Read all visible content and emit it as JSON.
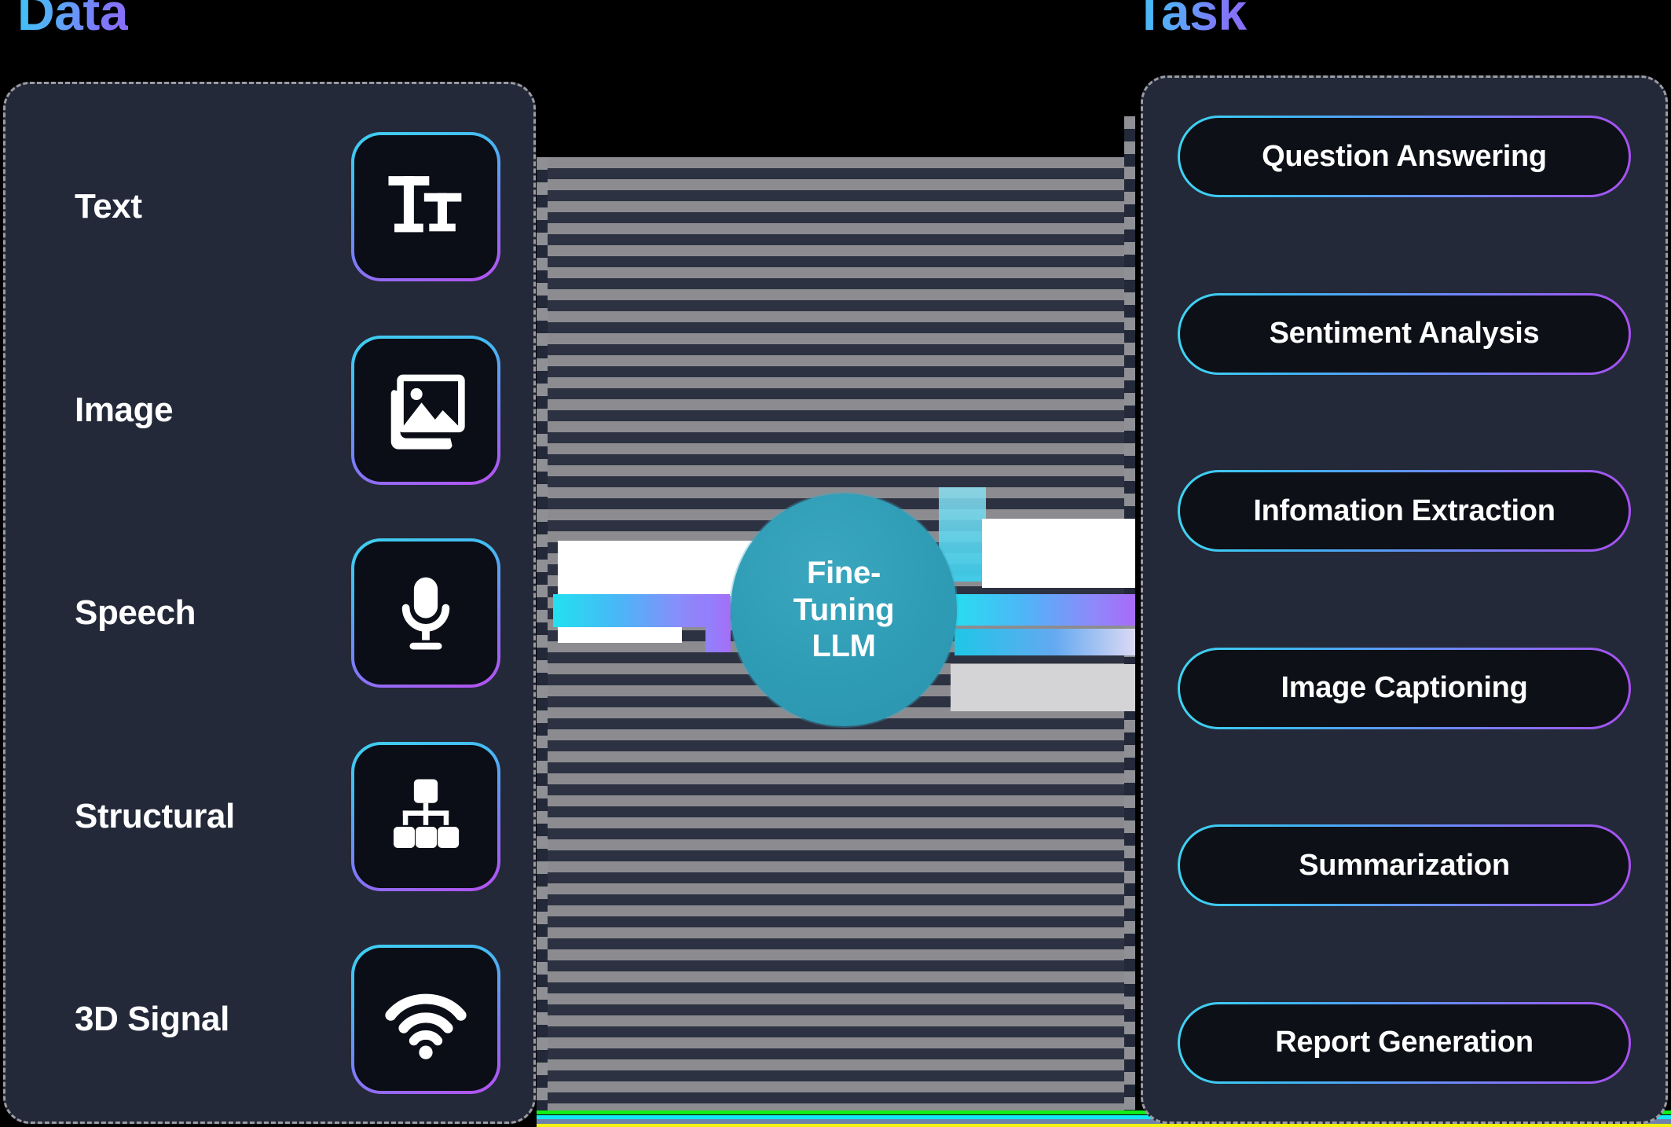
{
  "headings": {
    "left": "Data",
    "right": "Task"
  },
  "center": {
    "label": "Fine-\nTuning\nLLM",
    "color": "#2f9cb5"
  },
  "data_panel": {
    "modalities": [
      {
        "label": "Text",
        "icon": "text-format-icon"
      },
      {
        "label": "Image",
        "icon": "image-icon"
      },
      {
        "label": "Speech",
        "icon": "microphone-icon"
      },
      {
        "label": "Structural",
        "icon": "hierarchy-icon"
      },
      {
        "label": "3D Signal",
        "icon": "wifi-signal-icon"
      }
    ]
  },
  "task_panel": {
    "tasks": [
      {
        "label": "Question Answering"
      },
      {
        "label": "Sentiment Analysis"
      },
      {
        "label": "Infomation Extraction"
      },
      {
        "label": "Image Captioning"
      },
      {
        "label": "Summarization"
      },
      {
        "label": "Report Generation"
      }
    ]
  },
  "theme": {
    "panel_bg": "#232939",
    "tile_bg": "#0b0e16",
    "pill_bg": "#0d1017",
    "accent_cyan": "#3fd0f0",
    "accent_purple": "#a84ff0",
    "background": "#000000",
    "dashed_border": "#9b9ba0",
    "stripe_light": "#8c8c90",
    "stripe_dark": "#2d3242"
  }
}
